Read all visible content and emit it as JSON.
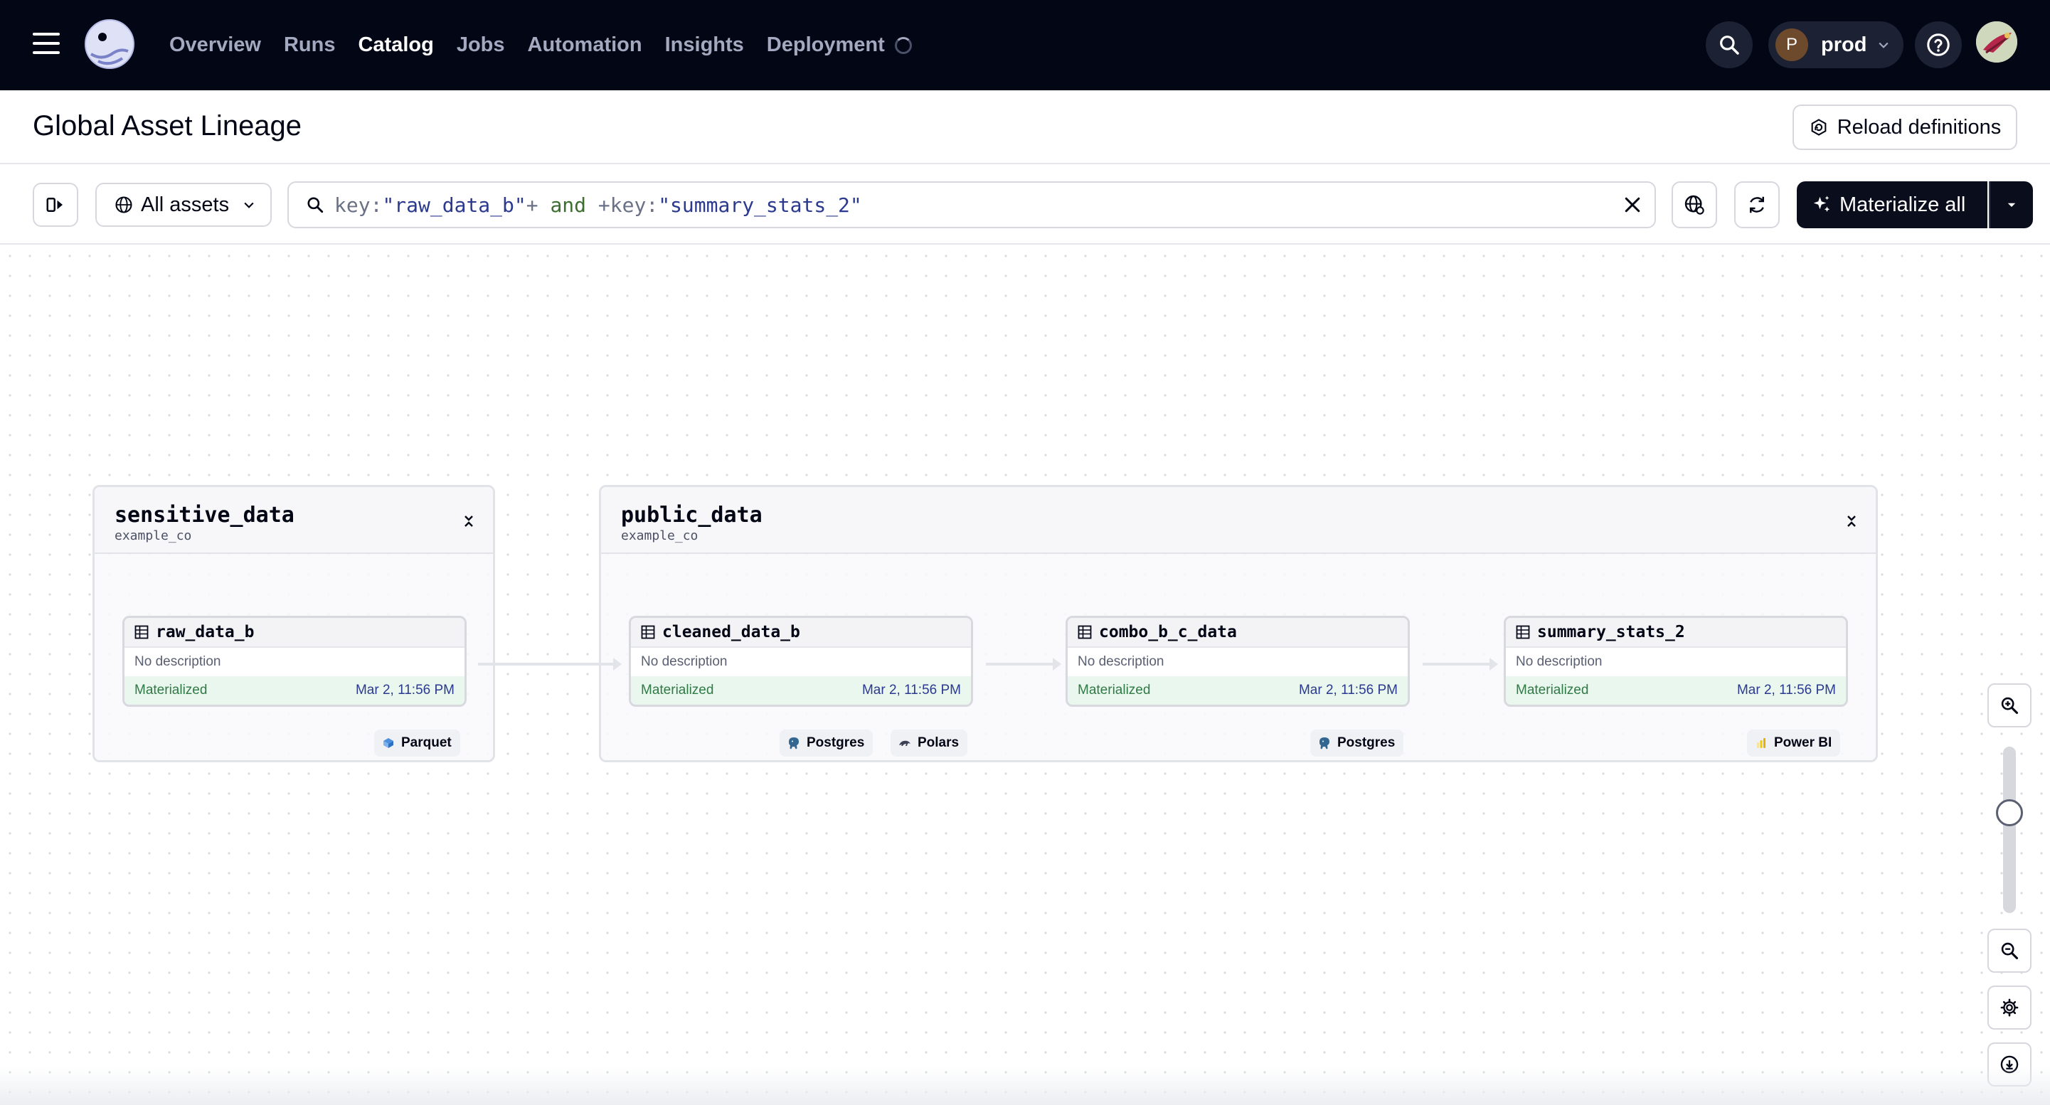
{
  "nav": {
    "links": [
      "Overview",
      "Runs",
      "Catalog",
      "Jobs",
      "Automation",
      "Insights",
      "Deployment"
    ],
    "active": "Catalog",
    "deployment_avatar": "P",
    "deployment_name": "prod"
  },
  "header": {
    "title": "Global Asset Lineage",
    "reload_label": "Reload definitions"
  },
  "toolbar": {
    "scope_label": "All assets",
    "query": {
      "k1": "key",
      "c1": ":",
      "v1": "\"raw_data_b\"",
      "p1": "+",
      "op": " and ",
      "p2": "+",
      "k2": "key",
      "c2": ":",
      "v2": "\"summary_stats_2\""
    },
    "materialize_label": "Materialize all"
  },
  "groups": [
    {
      "name": "sensitive_data",
      "location": "example_co",
      "assets": [
        {
          "name": "raw_data_b",
          "description": "No description",
          "status": "Materialized",
          "timestamp": "Mar 2, 11:56 PM",
          "kinds": [
            "Parquet"
          ]
        }
      ]
    },
    {
      "name": "public_data",
      "location": "example_co",
      "assets": [
        {
          "name": "cleaned_data_b",
          "description": "No description",
          "status": "Materialized",
          "timestamp": "Mar 2, 11:56 PM",
          "kinds": [
            "Postgres",
            "Polars"
          ]
        },
        {
          "name": "combo_b_c_data",
          "description": "No description",
          "status": "Materialized",
          "timestamp": "Mar 2, 11:56 PM",
          "kinds": [
            "Postgres"
          ]
        },
        {
          "name": "summary_stats_2",
          "description": "No description",
          "status": "Materialized",
          "timestamp": "Mar 2, 11:56 PM",
          "kinds": [
            "Power BI"
          ]
        }
      ]
    }
  ],
  "zoom": {
    "level": 0.62
  },
  "colors": {
    "nav_bg": "#030615",
    "materialized_bg": "#eaf7ee",
    "materialized_text": "#2f7a45",
    "timestamp_text": "#2b3a8f"
  },
  "icons": {
    "menu": "hamburger-icon",
    "logo": "dagster-logo",
    "search": "search-icon",
    "help": "help-icon",
    "reload": "reload-icon",
    "sidebar": "sidebar-toggle-icon",
    "globe": "globe-icon",
    "clear": "close-icon",
    "lineage": "lineage-globe-icon",
    "refresh": "refresh-icon",
    "materialize": "sparkle-icon",
    "table": "table-icon",
    "zoom_in": "zoom-in-icon",
    "zoom_out": "zoom-out-icon",
    "settings": "gear-icon",
    "download": "download-icon"
  }
}
